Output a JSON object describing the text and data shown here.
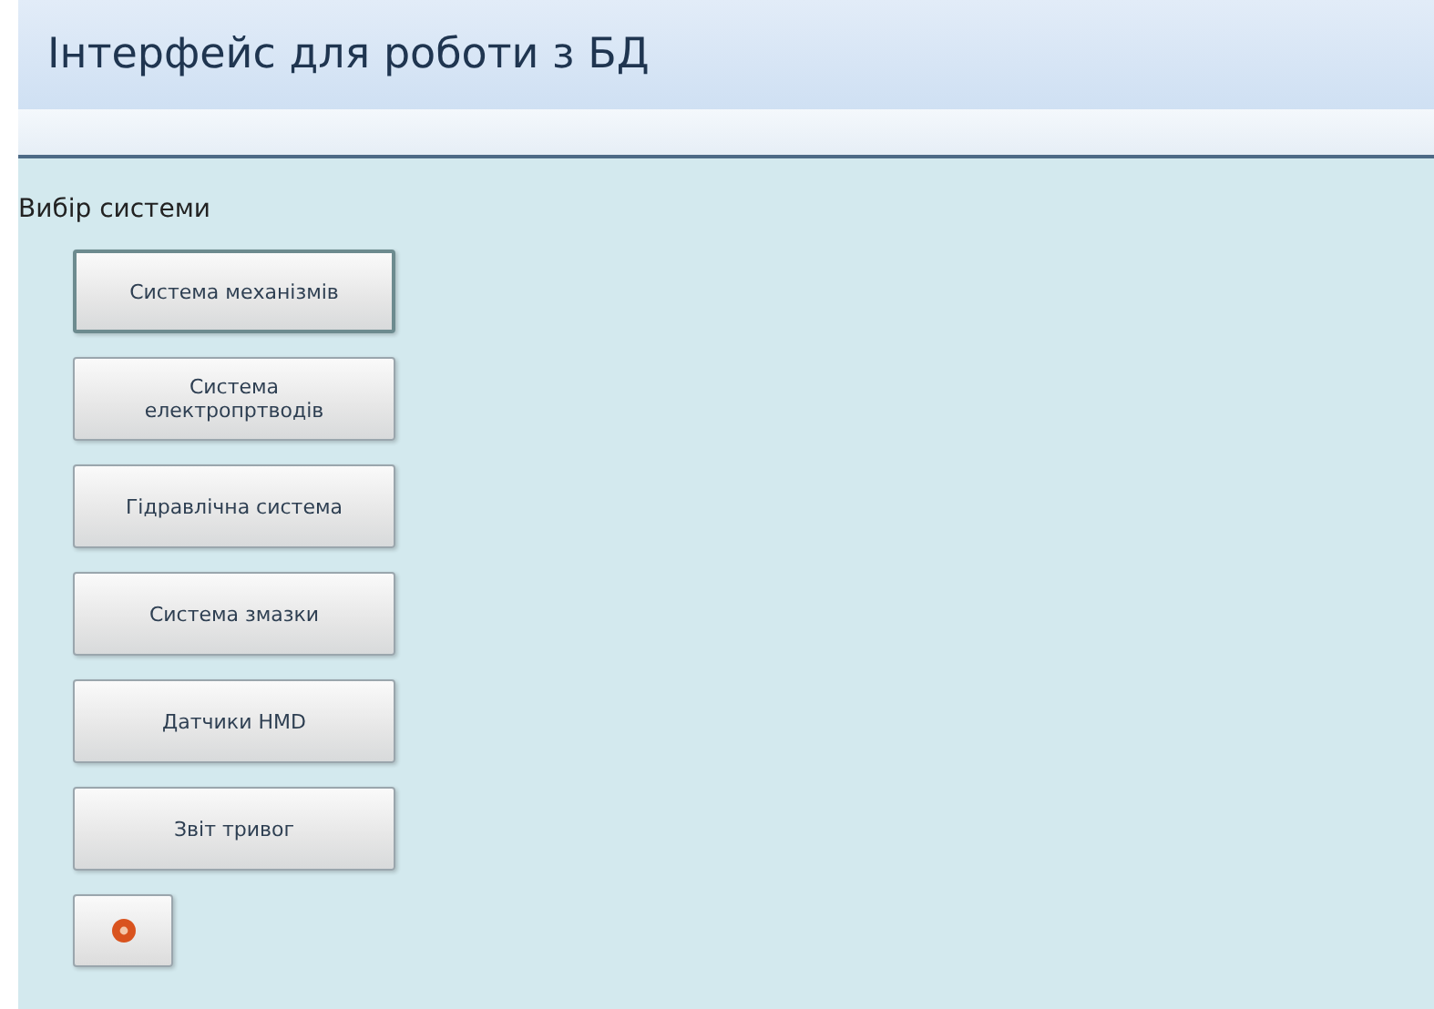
{
  "window": {
    "title": "Інтерфейс для роботи з БД"
  },
  "section": {
    "label": "Вибір системи"
  },
  "buttons": [
    {
      "label": "Система механізмів",
      "selected": true
    },
    {
      "label": "Система електропртводів",
      "selected": false
    },
    {
      "label": "Гідравлічна система",
      "selected": false
    },
    {
      "label": "Система змазки",
      "selected": false
    },
    {
      "label": "Датчики HMD",
      "selected": false
    },
    {
      "label": "Звіт тривог",
      "selected": false
    }
  ]
}
